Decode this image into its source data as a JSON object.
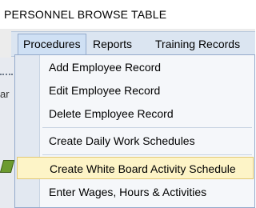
{
  "window": {
    "title": "PERSONNEL BROWSE TABLE"
  },
  "menubar": {
    "items": [
      {
        "label": "Procedures"
      },
      {
        "label": "Reports"
      },
      {
        "label": "Training Records"
      }
    ]
  },
  "left_panel": {
    "text": "ar"
  },
  "dropdown": {
    "items": [
      {
        "label": "Add Employee Record"
      },
      {
        "label": "Edit Employee Record"
      },
      {
        "label": "Delete Employee Record"
      },
      {
        "label": "Create Daily Work Schedules"
      },
      {
        "label": "Create White Board Activity Schedule"
      },
      {
        "label": "Enter Wages, Hours & Activities"
      }
    ],
    "highlighted_index": 4
  },
  "colors": {
    "menubar_bg": "#dbe5f1",
    "highlight_bg": "#fdf4c7",
    "highlight_border": "#e2c875"
  }
}
